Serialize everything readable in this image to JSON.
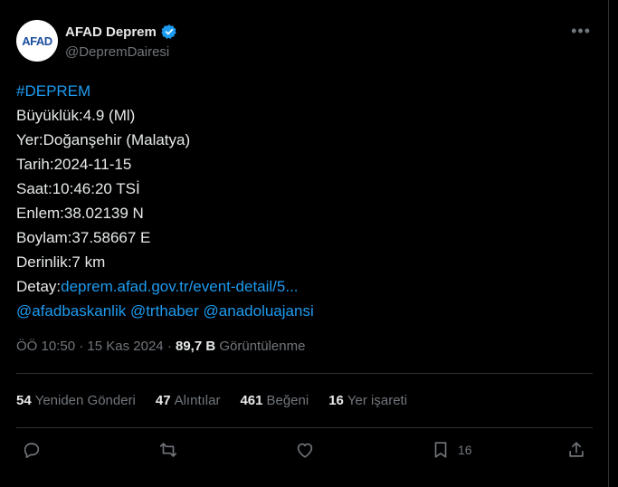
{
  "account": {
    "avatar_text": "AFAD",
    "display_name": "AFAD Deprem",
    "handle": "@DepremDairesi"
  },
  "post": {
    "lines": [
      {
        "label": "",
        "value": "#DEPREM"
      },
      {
        "label": "Büyüklük:",
        "value": "4.9 (Ml)"
      },
      {
        "label": "Yer:",
        "value": "Doğanşehir (Malatya)"
      },
      {
        "label": "Tarih:",
        "value": "2024-11-15"
      },
      {
        "label": "Saat:",
        "value": "10:46:20 TSİ"
      },
      {
        "label": "Enlem:",
        "value": "38.02139 N"
      },
      {
        "label": "Boylam:",
        "value": "37.58667 E"
      },
      {
        "label": "Derinlik:",
        "value": "7 km"
      },
      {
        "label": "Detay:",
        "value": "deprem.afad.gov.tr/event-detail/5..."
      }
    ],
    "mentions": [
      "@afadbaskanlik",
      "@trthaber",
      "@anadoluajansi"
    ]
  },
  "meta": {
    "time": "ÖÖ 10:50",
    "date": "15 Kas 2024",
    "views_count": "89,7 B",
    "views_label": "Görüntülenme"
  },
  "stats": [
    {
      "count": "54",
      "label": "Yeniden Gönderi"
    },
    {
      "count": "47",
      "label": "Alıntılar"
    },
    {
      "count": "461",
      "label": "Beğeni"
    },
    {
      "count": "16",
      "label": "Yer işareti"
    }
  ],
  "actions": {
    "bookmark_count": "16"
  },
  "colors": {
    "background": "#000000",
    "link": "#1d9bf0",
    "text": "#e7e9ea",
    "muted": "#71767b",
    "border": "#2f3336"
  }
}
